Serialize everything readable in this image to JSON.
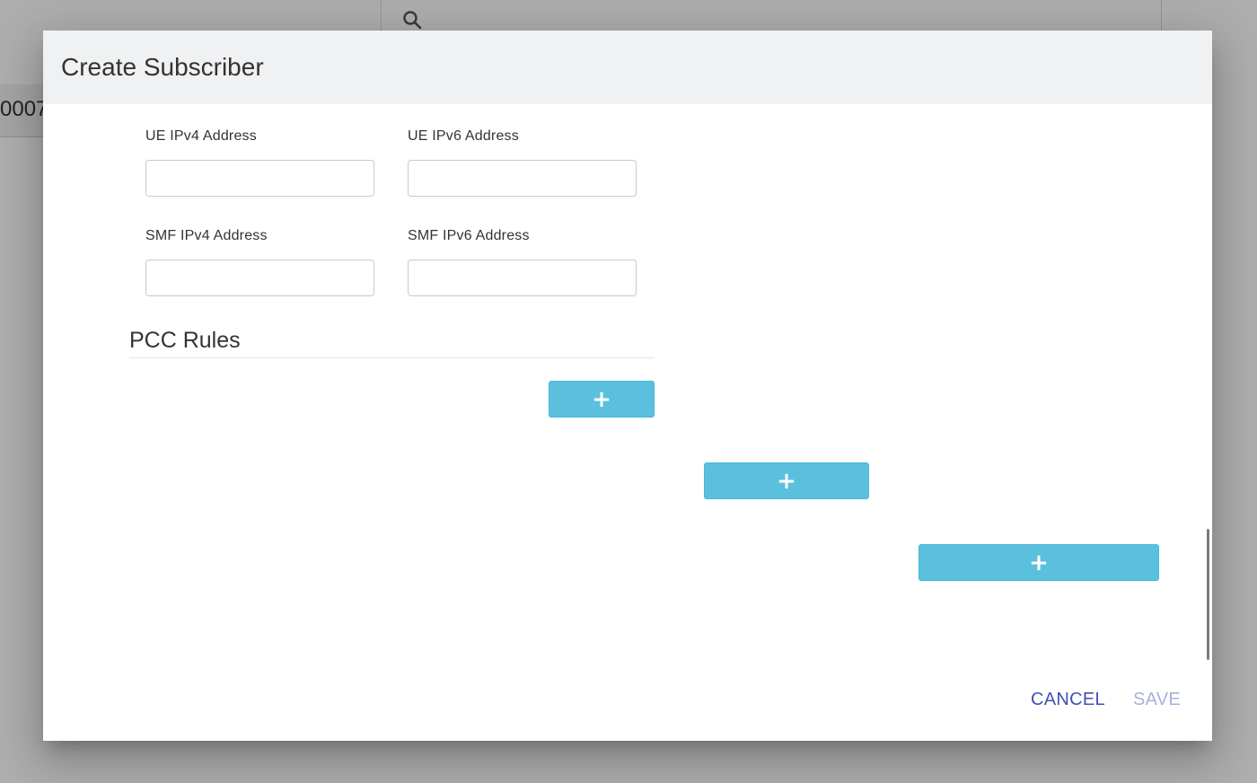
{
  "background": {
    "row_text": "0007"
  },
  "dialog": {
    "title": "Create Subscriber",
    "fields": {
      "ue_ipv4": {
        "label": "UE IPv4 Address",
        "value": ""
      },
      "ue_ipv6": {
        "label": "UE IPv6 Address",
        "value": ""
      },
      "smf_ipv4": {
        "label": "SMF IPv4 Address",
        "value": ""
      },
      "smf_ipv6": {
        "label": "SMF IPv6 Address",
        "value": ""
      }
    },
    "pcc_section": {
      "title": "PCC Rules"
    },
    "add_buttons": [
      "+",
      "+",
      "+"
    ],
    "actions": {
      "cancel": "CANCEL",
      "save": "SAVE"
    }
  },
  "icons": {
    "search": "search-icon",
    "add": "plus-icon"
  },
  "colors": {
    "primary": "#3f51b5",
    "primary_disabled": "#a7b0e0",
    "info_button": "#5bc0de",
    "header_bg": "#f0f1f2"
  }
}
